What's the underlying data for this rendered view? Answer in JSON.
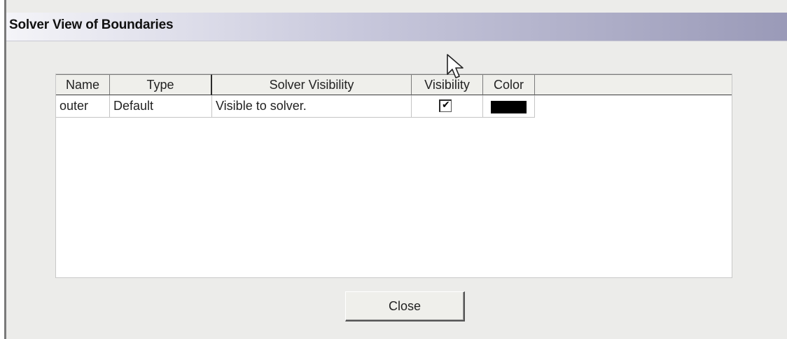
{
  "window": {
    "title": "Solver View of Boundaries"
  },
  "table": {
    "columns": [
      {
        "key": "name",
        "label": "Name"
      },
      {
        "key": "type",
        "label": "Type"
      },
      {
        "key": "solver_visibility",
        "label": "Solver Visibility"
      },
      {
        "key": "visibility",
        "label": "Visibility"
      },
      {
        "key": "color",
        "label": "Color"
      }
    ],
    "rows": [
      {
        "name": "outer",
        "type": "Default",
        "solver_visibility": "Visible to solver.",
        "visibility": true,
        "color": "#000000"
      }
    ]
  },
  "buttons": {
    "close_label": "Close"
  },
  "icons": {
    "checkmark": "✔",
    "cursor": "mouse-pointer-icon"
  }
}
